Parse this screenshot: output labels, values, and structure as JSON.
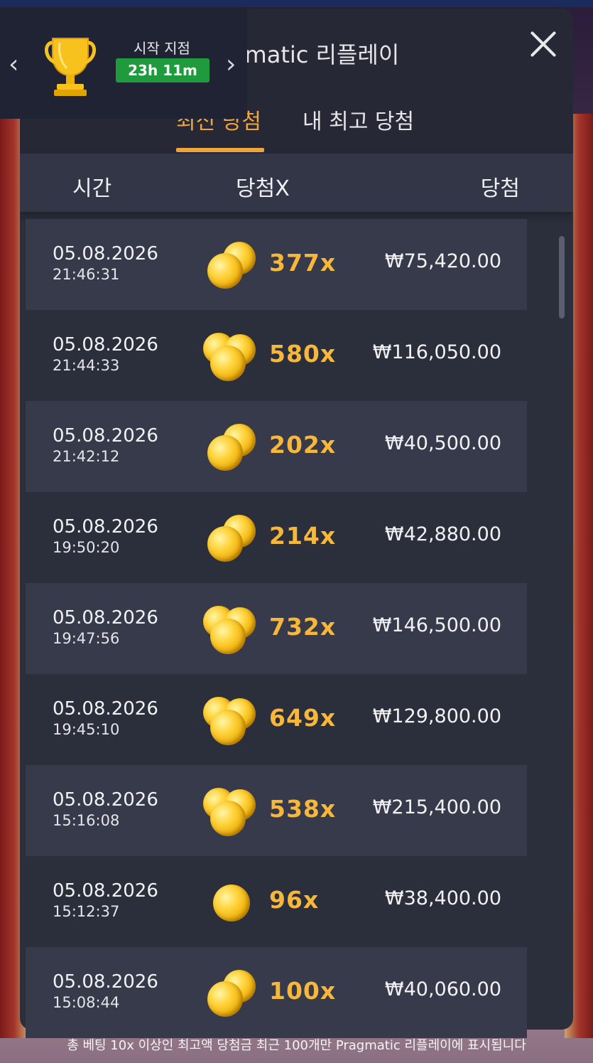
{
  "header": {
    "title": "Pragmatic 리플레이"
  },
  "tabs": [
    {
      "label": "최신 당첨",
      "active": true
    },
    {
      "label": "내 최고 당첨",
      "active": false
    }
  ],
  "columns": {
    "time": "시간",
    "multiplier": "당첨X",
    "win": "당첨"
  },
  "rows": [
    {
      "date": "05.08.2026",
      "time": "21:46:31",
      "multiplier": "377x",
      "win": "₩75,420.00",
      "coins": 2
    },
    {
      "date": "05.08.2026",
      "time": "21:44:33",
      "multiplier": "580x",
      "win": "₩116,050.00",
      "coins": 3
    },
    {
      "date": "05.08.2026",
      "time": "21:42:12",
      "multiplier": "202x",
      "win": "₩40,500.00",
      "coins": 2
    },
    {
      "date": "05.08.2026",
      "time": "19:50:20",
      "multiplier": "214x",
      "win": "₩42,880.00",
      "coins": 2
    },
    {
      "date": "05.08.2026",
      "time": "19:47:56",
      "multiplier": "732x",
      "win": "₩146,500.00",
      "coins": 3
    },
    {
      "date": "05.08.2026",
      "time": "19:45:10",
      "multiplier": "649x",
      "win": "₩129,800.00",
      "coins": 3
    },
    {
      "date": "05.08.2026",
      "time": "15:16:08",
      "multiplier": "538x",
      "win": "₩215,400.00",
      "coins": 3
    },
    {
      "date": "05.08.2026",
      "time": "15:12:37",
      "multiplier": "96x",
      "win": "₩38,400.00",
      "coins": 1
    },
    {
      "date": "05.08.2026",
      "time": "15:08:44",
      "multiplier": "100x",
      "win": "₩40,060.00",
      "coins": 2
    }
  ],
  "footer": {
    "note": "총 베팅 10x 이상인 최고액 당첨금 최근 100개만 Pragmatic 리플레이에 표시됩니다"
  },
  "tournament": {
    "label": "시작 지점",
    "timer": "23h 11m",
    "icon": "trophy-icon"
  },
  "colors": {
    "accent": "#f2a53a",
    "panel": "#2b2e3b",
    "timer_bg": "#1f9a3c",
    "multiplier": "#f6b73a"
  }
}
